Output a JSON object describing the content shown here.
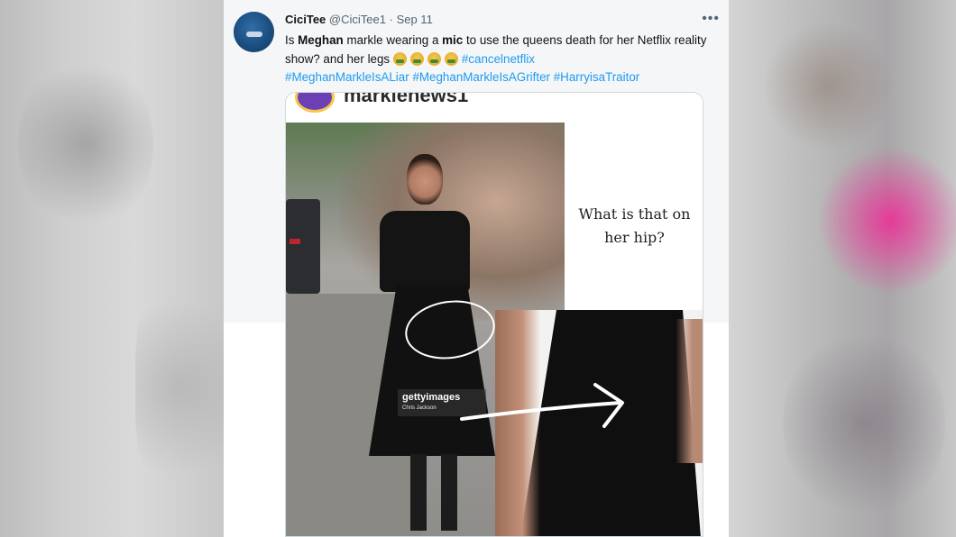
{
  "tweet": {
    "display_name": "CiciTee",
    "handle": "@CiciTee1",
    "separator": "·",
    "date": "Sep 11",
    "more_label": "•••",
    "text": {
      "p1": "Is ",
      "p2": "Meghan",
      "p3": " markle wearing a ",
      "p4": "mic",
      "p5": " to use the queens death for her Netflix reality show? and her legs ",
      "emoji_name": "nauseated-face-emoji",
      "emoji_count": 4,
      "hashtags": [
        "#cancelnetflix",
        "#MeghanMarkleIsALiar",
        "#MeghanMarkleIsAGrifter",
        "#HarryisaTraitor"
      ]
    }
  },
  "media": {
    "ig_account": "marklenews1",
    "caption_line1": "What is that on",
    "caption_line2": "her hip?",
    "watermark_brand": "gettyimages",
    "watermark_credit": "Chris Jackson"
  },
  "colors": {
    "link": "#1d9bf0",
    "text": "#0f1419",
    "muted": "#536471",
    "accent_pink": "#f028a0"
  }
}
